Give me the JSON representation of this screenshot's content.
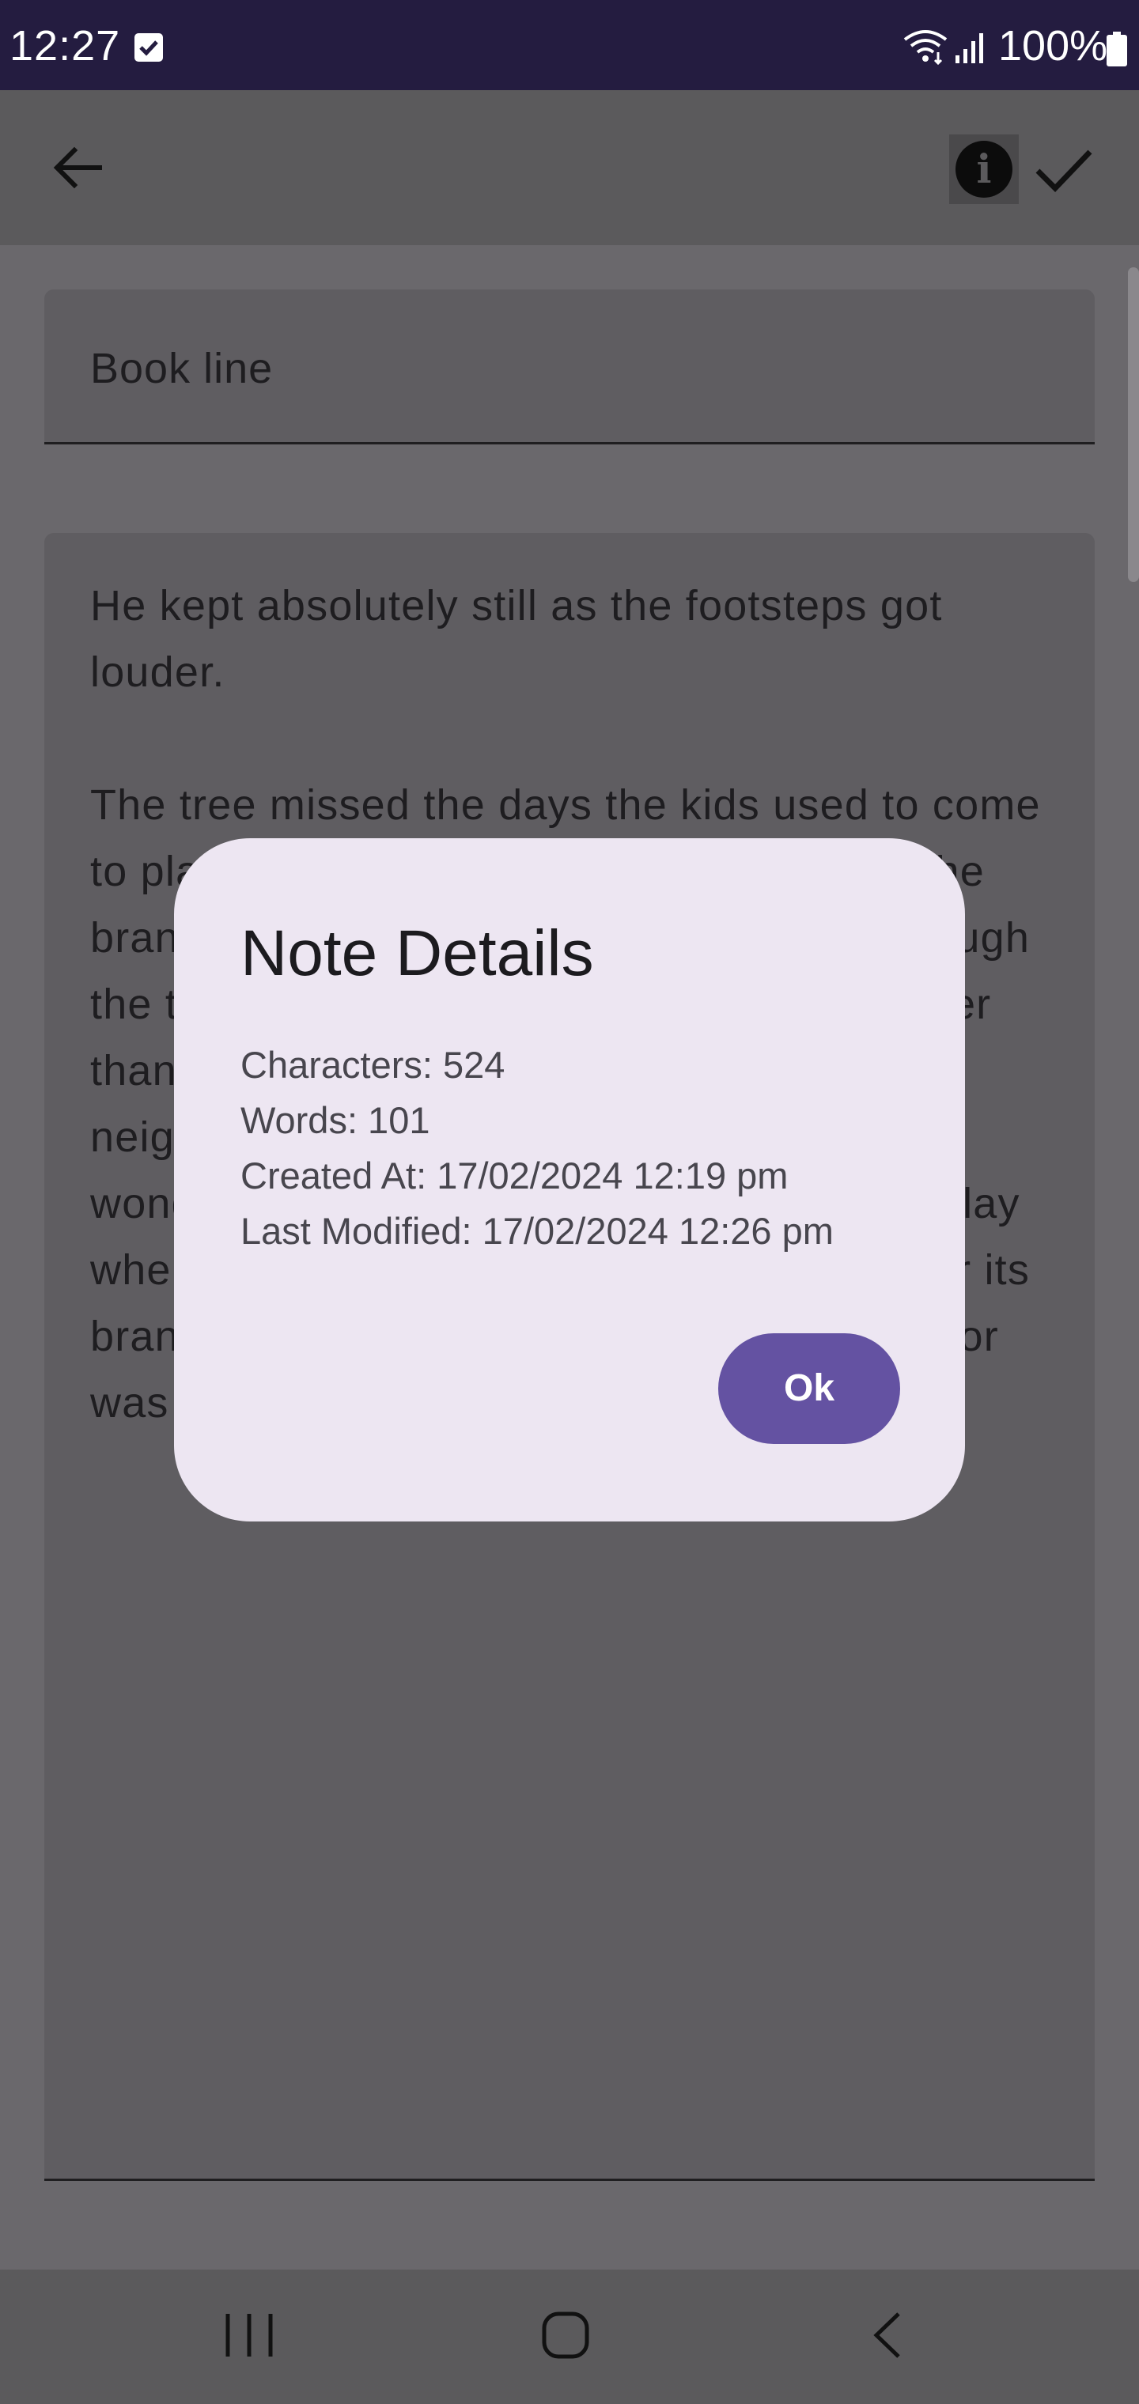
{
  "status_bar": {
    "time": "12:27",
    "battery_percent": "100%",
    "icons": [
      "checkbox-notification-icon",
      "wifi-icon",
      "signal-icon",
      "battery-icon"
    ]
  },
  "app_bar": {
    "back_icon": "arrow-back-icon",
    "info_icon": "info-icon",
    "save_icon": "check-icon"
  },
  "note": {
    "title": "Book line",
    "body": "He kept absolutely still as the footsteps got louder.\n\nThe tree missed the days the kids used to come to play under it, having fun while climbing the branches. It was a long, long time ago although the tree could remember when the kids better than they could themselves. Kids in the neighborhood would come around it and it wondered whether one day, it would again play when another kid would swing and fall under its branches. For now, all that the tree wished for was to fill the ever-growing emptiness."
  },
  "dialog": {
    "title": "Note Details",
    "characters": "Characters: 524",
    "words": "Words: 101",
    "created_at": "Created At: 17/02/2024 12:19 pm",
    "last_modified": "Last Modified: 17/02/2024 12:26 pm",
    "ok_label": "Ok"
  },
  "nav_bar": {
    "icons": [
      "recent-apps-icon",
      "home-icon",
      "back-icon"
    ]
  },
  "colors": {
    "status_bar": "#241c40",
    "scrim_background": "#6a686c",
    "dialog_background": "#ede6f2",
    "primary_button": "#6452a2"
  }
}
